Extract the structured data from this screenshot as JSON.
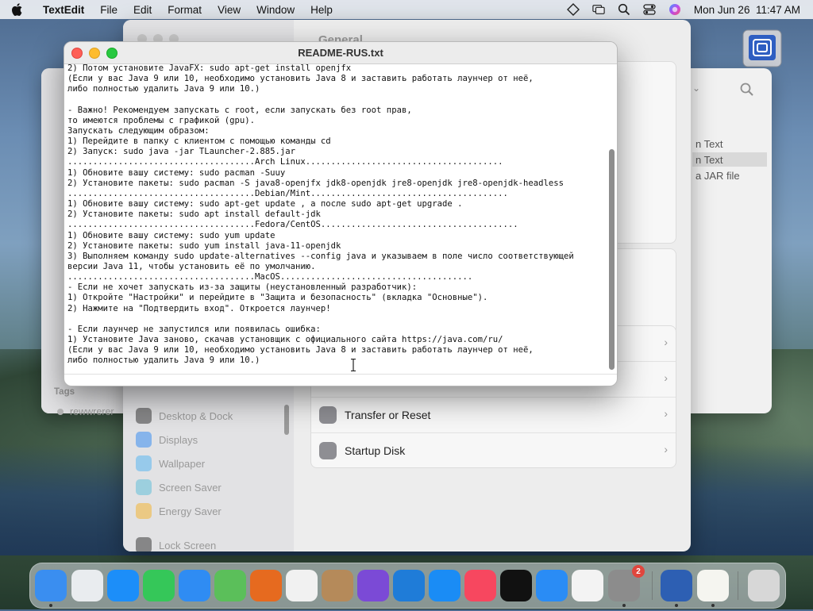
{
  "menubar": {
    "apple": "",
    "app_name": "TextEdit",
    "menus": [
      "File",
      "Edit",
      "Format",
      "View",
      "Window",
      "Help"
    ],
    "datetime": "Mon Jun 26  11:47 AM"
  },
  "system_preferences": {
    "title": "General",
    "sidebar": {
      "items": [
        "Desktop & Dock",
        "Displays",
        "Wallpaper",
        "Screen Saver",
        "Energy Saver",
        "Lock Screen"
      ]
    },
    "rows": [
      "Transfer or Reset",
      "Startup Disk"
    ]
  },
  "finder": {
    "list_items": [
      "n Text",
      "n Text",
      "a JAR file"
    ],
    "tags_label": "Tags",
    "tag_item": "rewwrerer"
  },
  "textedit": {
    "title": "README-RUS.txt",
    "lines": [
      "2) Потом установите JavaFX: sudo apt-get install openjfx",
      "(Если у вас Java 9 или 10, необходимо установить Java 8 и заставить работать лаунчер от неё,",
      "либо полностью удалить Java 9 или 10.)",
      "",
      "- Важно! Рекомендуем запускать с root, если запускать без root прав,",
      "то имеются проблемы с графикой (gpu).",
      "Запускать следующим образом:",
      "1) Перейдите в папку с клиентом с помощью команды cd",
      "2) Запуск: sudo java -jar TLauncher-2.885.jar",
      ".....................................Arch Linux.......................................",
      "1) Обновите вашу систему: sudo pacman -Suuy",
      "2) Установите пакеты: sudo pacman -S java8-openjfx jdk8-openjdk jre8-openjdk jre8-openjdk-headless",
      ".....................................Debian/Mint.......................................",
      "1) Обновите вашу систему: sudo apt-get update , а после sudo apt-get upgrade .",
      "2) Установите пакеты: sudo apt install default-jdk",
      ".....................................Fedora/CentOS.......................................",
      "1) Обновите вашу систему: sudo yum update",
      "2) Установите пакеты: sudo yum install java-11-openjdk",
      "3) Выполняем команду sudo update-alternatives --config java и указываем в поле число соответствующей",
      "версии Java 11, чтобы установить её по умолчанию.",
      ".....................................MacOS......................................",
      "- Если не хочет запускать из-за защиты (неустановленный разработчик):",
      "1) Откройте \"Настройки\" и перейдите в \"Защита и безопасность\" (вкладка \"Основные\").",
      "2) Нажмите на \"Подтвердить вход\". Откроется лаунчер!",
      "",
      "- Если лаунчер не запустился или появилась ошибка:",
      "1) Установите Java заново, скачав установщик с официального сайта https://java.com/ru/",
      "(Если у вас Java 9 или 10, необходимо установить Java 8 и заставить работать лаунчер от неё,",
      "либо полностью удалить Java 9 или 10.)"
    ]
  },
  "dock": {
    "apps": [
      {
        "name": "Finder",
        "icon": "finder-icon",
        "color": "#3a8ef0"
      },
      {
        "name": "Launchpad",
        "icon": "launchpad-icon",
        "color": "#e9ecef"
      },
      {
        "name": "Safari",
        "icon": "safari-icon",
        "color": "#1c8ef9"
      },
      {
        "name": "Messages",
        "icon": "messages-icon",
        "color": "#35c759"
      },
      {
        "name": "Mail",
        "icon": "mail-icon",
        "color": "#2f8cf3"
      },
      {
        "name": "Maps",
        "icon": "maps-icon",
        "color": "#5bbf5a"
      },
      {
        "name": "Firefox",
        "icon": "firefox-icon",
        "color": "#e66a1f"
      },
      {
        "name": "Chrome",
        "icon": "chrome-icon",
        "color": "#f1f1f1"
      },
      {
        "name": "Contacts",
        "icon": "contacts-icon",
        "color": "#b58a5a"
      },
      {
        "name": "Visual Studio",
        "icon": "visual-studio-icon",
        "color": "#7b4ad6"
      },
      {
        "name": "VS Code",
        "icon": "vscode-icon",
        "color": "#1f7cd8"
      },
      {
        "name": "App Store",
        "icon": "app-store-icon",
        "color": "#1a8cf5"
      },
      {
        "name": "Music",
        "icon": "music-icon",
        "color": "#f7475f"
      },
      {
        "name": "Apple TV",
        "icon": "apple-tv-icon",
        "color": "#111111"
      },
      {
        "name": "Keynote",
        "icon": "keynote-icon",
        "color": "#2a8cf5"
      },
      {
        "name": "News",
        "icon": "news-icon",
        "color": "#f3f3f3"
      },
      {
        "name": "System Preferences",
        "icon": "system-preferences-icon",
        "color": "#8c8c8c",
        "badge": "2"
      },
      {
        "name": "Disk Utility",
        "icon": "disk-utility-icon",
        "color": "#2d5fb3"
      },
      {
        "name": "TextEdit",
        "icon": "textedit-icon",
        "color": "#f5f5f0"
      },
      {
        "name": "Trash",
        "icon": "trash-icon",
        "color": "#d7d7d7"
      }
    ]
  }
}
